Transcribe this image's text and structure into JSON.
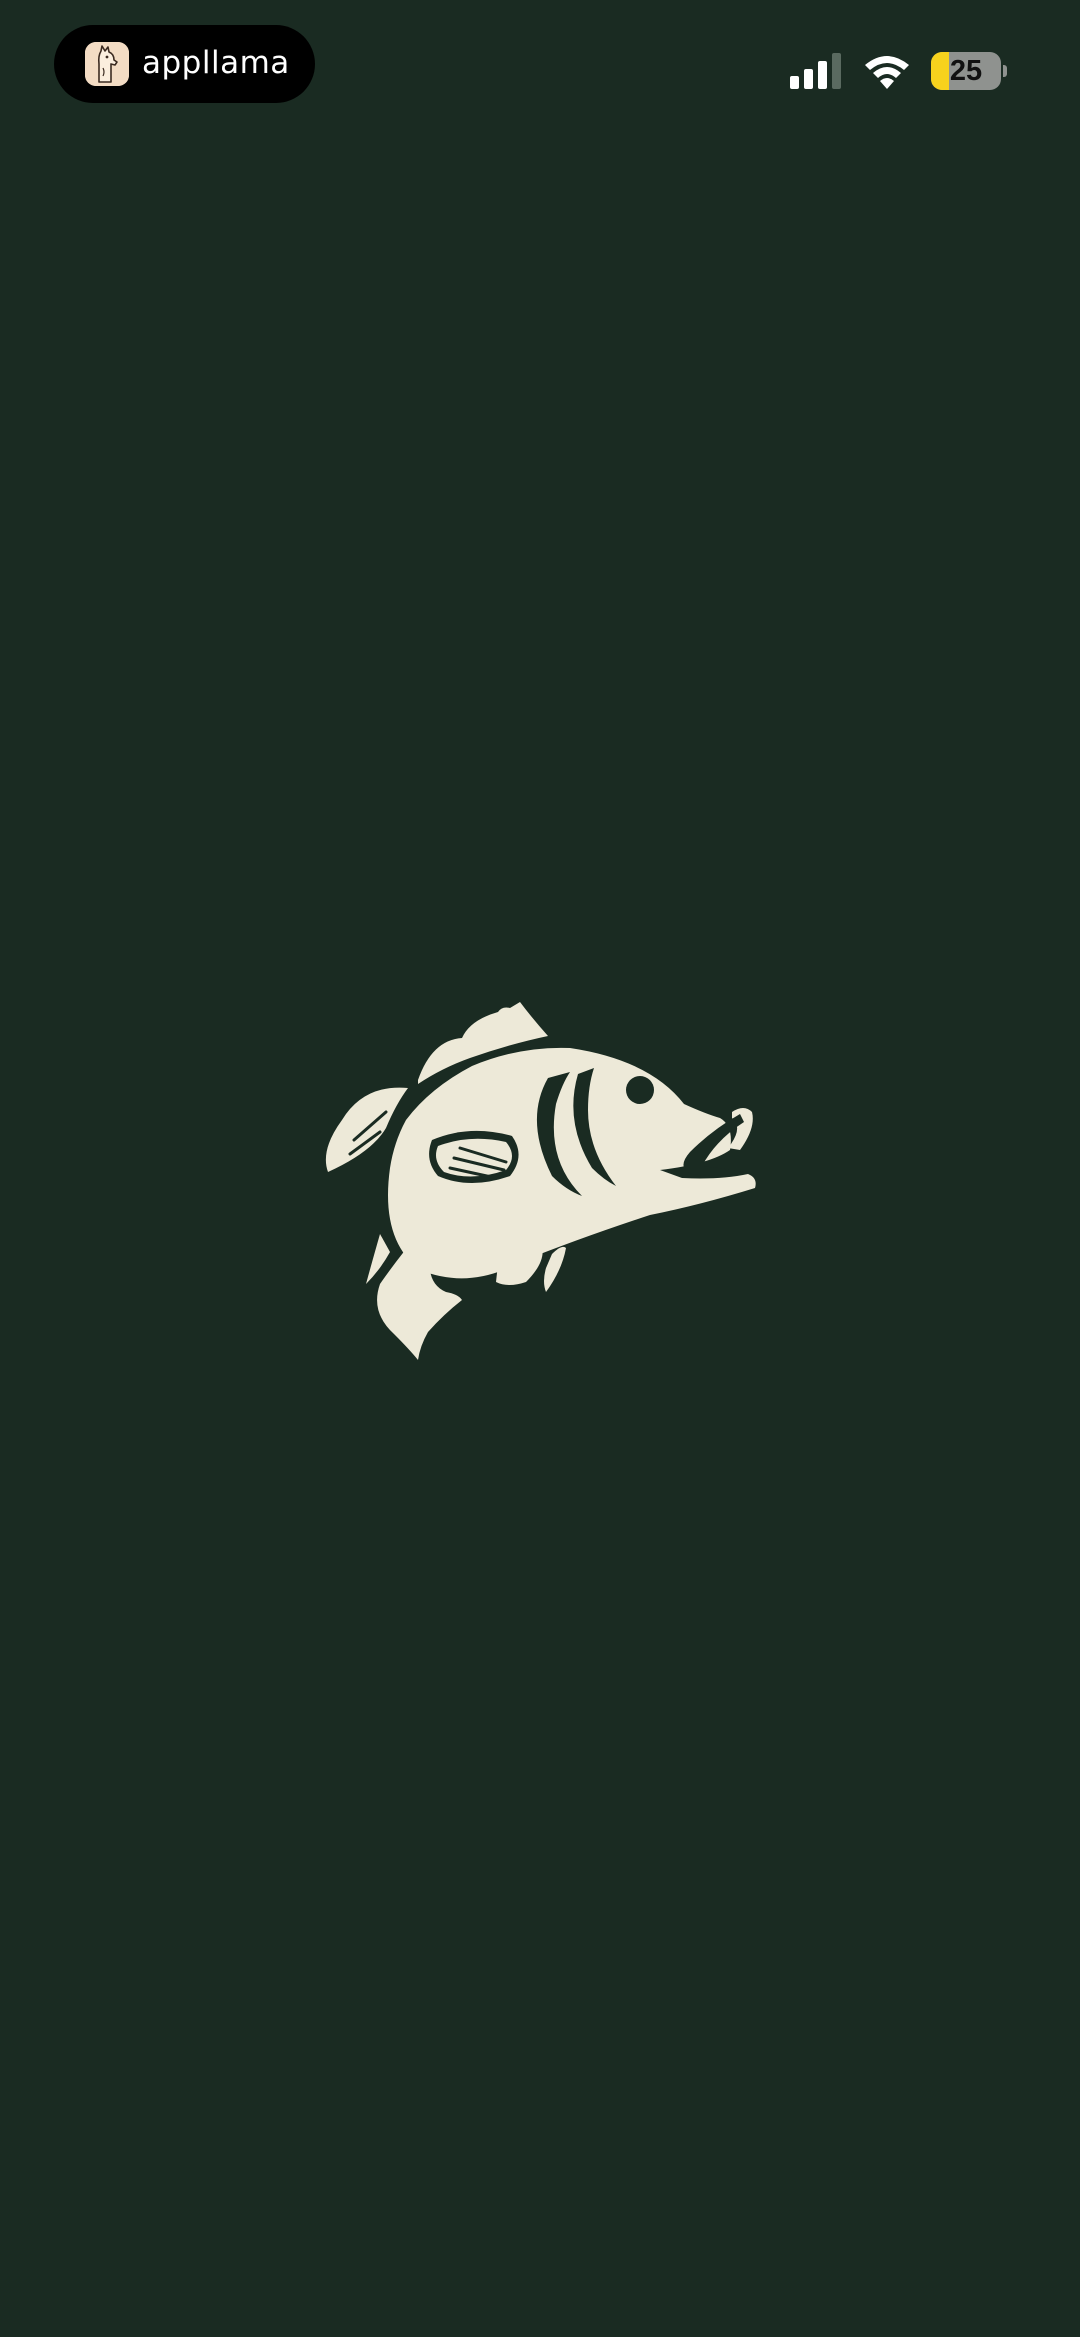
{
  "status_bar": {
    "app_name": "appllama",
    "battery_level": "25",
    "battery_fraction": 0.25,
    "signal_bars_active": 3,
    "signal_bars_total": 4
  },
  "splash": {
    "logo_icon": "jumping-bass-fish-icon"
  },
  "colors": {
    "background": "#1a2b22",
    "logo": "#ede9d8",
    "battery_fill": "#f7d21d"
  }
}
